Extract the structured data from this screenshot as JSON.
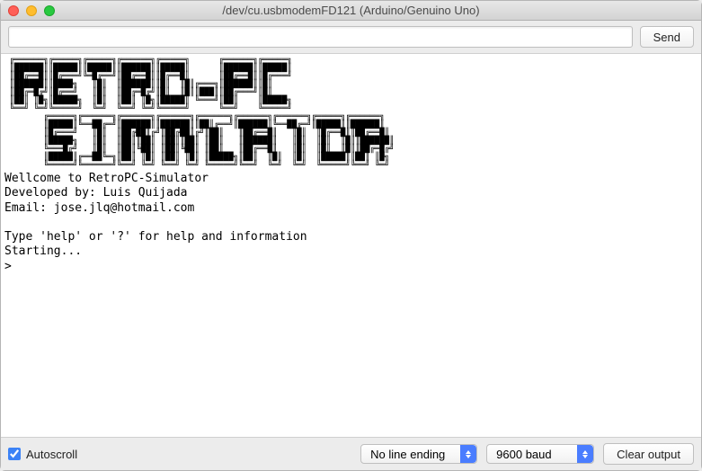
{
  "window": {
    "title": "/dev/cu.usbmodemFD121 (Arduino/Genuino Uno)"
  },
  "toolbar": {
    "input_value": "",
    "send_label": "Send"
  },
  "console": {
    "ascii_art": " ╔══════╗╔═════╗╔═════╗╔══════╗╔═════╗      ╔══════╗╔═════╗\n ║██████║║█████║║█████║║██████║║█████║      ║██████║║█████║\n ║██╔══█║║█╔═══╝╚═█╔══╝║██╔══█║║█╔══█║      ║██╔══█║║█╔═══╝\n ║██████║║████╗   ║█║  ║██████║║█║  ║█║╔═══╗║██████║║█║\n ║██╔═█╔╝║█╔══╝   ║█║  ║██╔═█╔╝║█║  ║█║║███║║██╔═══╝║█║\n ║██║ ║█╗║█████╗  ║█║  ║██║ ║█╗║█████║ ╚═══╝║██║    ║█████╗\n ╚══╝ ╚═╝╚═════╝  ╚═╝  ╚══╝ ╚═╝╚═════╝      ╚══╝    ╚═════╝\n        ╔═════╗╔══════╗╔══════╗╔══════╗╔══════╗╔══════╗╔══════╗╔═════╗╔══════╗\n        ║█████║╚══██╔═╝║██████║║██████║║██║╔══╝║██████║╚══██╔═╝║█████║║██████║\n        ║█╔═══╝   ║█║  ║██╔██║╔╝║██╔██║╔╝║██║   ║██╔══█║   ║█║  ║█╔══█║║██╔══█║\n        ║█████╗   ║█║  ║██║║██║ ║██║║██║ ║██║   ║██████║   ║█║  ║█║  ║█║║██████║\n        ╚═══█╔╝   ║█║  ║██║╚██║ ║██║╚██║ ║██║   ║██╔══█║   ║█║  ║█║  ║█║║██╔═█╔╝\n        ║█████║╔══██╚═╗║██║ ║█║ ║██║ ║█║ ║█████╗║██║  ║█║  ║█║  ║█████║║██║ ║█╗\n        ╚═════╝╚══════╝╚══╝ ╚═╝ ╚══╝ ╚═╝ ╚═════╝╚══╝  ╚═╝  ╚═╝  ╚═════╝╚══╝ ╚═╝",
    "text": "Wellcome to RetroPC-Simulator\nDeveloped by: Luis Quijada\nEmail: jose.jlq@hotmail.com\n\nType 'help' or '?' for help and information\nStarting...\n>"
  },
  "footer": {
    "autoscroll_label": "Autoscroll",
    "autoscroll_checked": true,
    "line_ending": "No line ending",
    "baud_rate": "9600 baud",
    "clear_label": "Clear output"
  }
}
